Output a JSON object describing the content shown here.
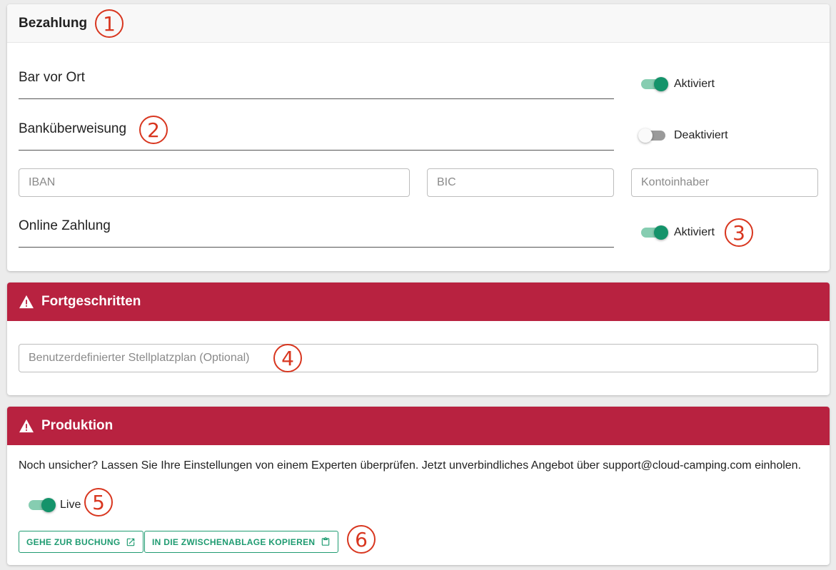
{
  "payment": {
    "title": "Bezahlung",
    "methods": [
      {
        "label": "Bar vor Ort",
        "status": "Aktiviert",
        "enabled": true
      },
      {
        "label": "Banküberweisung",
        "status": "Deaktiviert",
        "enabled": false
      },
      {
        "label": "Online Zahlung",
        "status": "Aktiviert",
        "enabled": true
      }
    ],
    "bank_fields": {
      "iban_placeholder": "IBAN",
      "bic_placeholder": "BIC",
      "holder_placeholder": "Kontoinhaber"
    }
  },
  "advanced": {
    "title": "Fortgeschritten",
    "pitch_plan_placeholder": "Benutzerdefinierter Stellplatzplan (Optional)"
  },
  "production": {
    "title": "Produktion",
    "info": "Noch unsicher? Lassen Sie Ihre Einstellungen von einem Experten überprüfen. Jetzt unverbindliches Angebot über support@cloud-camping.com einholen.",
    "live_label": "Live",
    "live_enabled": true,
    "goto_booking_label": "GEHE ZUR BUCHUNG",
    "copy_clipboard_label": "IN DIE ZWISCHENABLAGE KOPIEREN"
  },
  "markers": [
    "1",
    "2",
    "3",
    "4",
    "5",
    "6"
  ],
  "colors": {
    "accent": "#14936a",
    "danger": "#b82240",
    "marker": "#d8361f"
  }
}
